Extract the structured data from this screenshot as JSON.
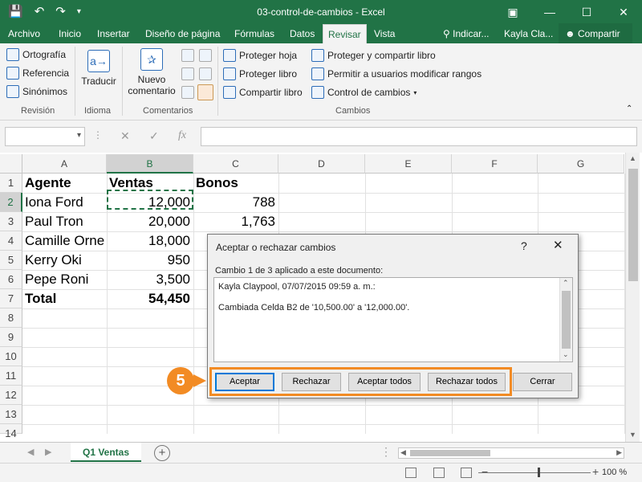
{
  "window": {
    "title": "03-control-de-cambios  -  Excel"
  },
  "tabs": [
    "Archivo",
    "Inicio",
    "Insertar",
    "Diseño de página",
    "Fórmulas",
    "Datos",
    "Revisar",
    "Vista"
  ],
  "tab_active": "Revisar",
  "tell_me": "Indicar...",
  "user": "Kayla Cla...",
  "share": "Compartir",
  "ribbon": {
    "revision": {
      "ortografia": "Ortografía",
      "referencia": "Referencia",
      "sinonimos": "Sinónimos",
      "label": "Revisión"
    },
    "idioma": {
      "traducir": "Traducir",
      "label": "Idioma"
    },
    "comentarios": {
      "nuevo1": "Nuevo",
      "nuevo2": "comentario",
      "label": "Comentarios"
    },
    "cambios": {
      "proteger_hoja": "Proteger hoja",
      "proteger_libro": "Proteger libro",
      "compartir_libro": "Compartir libro",
      "proteger_compartir": "Proteger y compartir libro",
      "permitir_rangos": "Permitir a usuarios modificar rangos",
      "control_cambios": "Control de cambios",
      "label": "Cambios"
    }
  },
  "formula_bar": {
    "fx": "fx",
    "cancel": "✕",
    "enter": "✓"
  },
  "columns": [
    "A",
    "B",
    "C",
    "D",
    "E",
    "F",
    "G"
  ],
  "rows": [
    "1",
    "2",
    "3",
    "4",
    "5",
    "6",
    "7",
    "8",
    "9",
    "10",
    "11",
    "12",
    "13",
    "14"
  ],
  "cells": {
    "A1": "Agente",
    "B1": "Ventas",
    "C1": "Bonos",
    "A2": "Iona Ford",
    "B2": "12,000",
    "C2": "788",
    "A3": "Paul Tron",
    "B3": "20,000",
    "C3": "1,763",
    "A4": "Camille  Orne",
    "B4": "18,000",
    "A5": "Kerry Oki",
    "B5": "950",
    "A6": "Pepe Roni",
    "B6": "3,500",
    "A7": "Total",
    "B7": "54,450"
  },
  "sheet_tab": "Q1 Ventas",
  "zoom": "100 %",
  "dialog": {
    "title": "Aceptar o rechazar cambios",
    "help": "?",
    "close": "✕",
    "label": "Cambio 1 de 3 aplicado a este documento:",
    "line1": "Kayla Claypool, 07/07/2015 09:59 a. m.:",
    "line2": "Cambiada Celda B2 de '10,500.00' a '12,000.00'.",
    "buttons": {
      "aceptar": "Aceptar",
      "rechazar": "Rechazar",
      "aceptar_todos": "Aceptar todos",
      "rechazar_todos": "Rechazar todos",
      "cerrar": "Cerrar"
    }
  },
  "callout": "5",
  "colors": {
    "excel_green": "#217346",
    "callout_orange": "#f28b24"
  }
}
